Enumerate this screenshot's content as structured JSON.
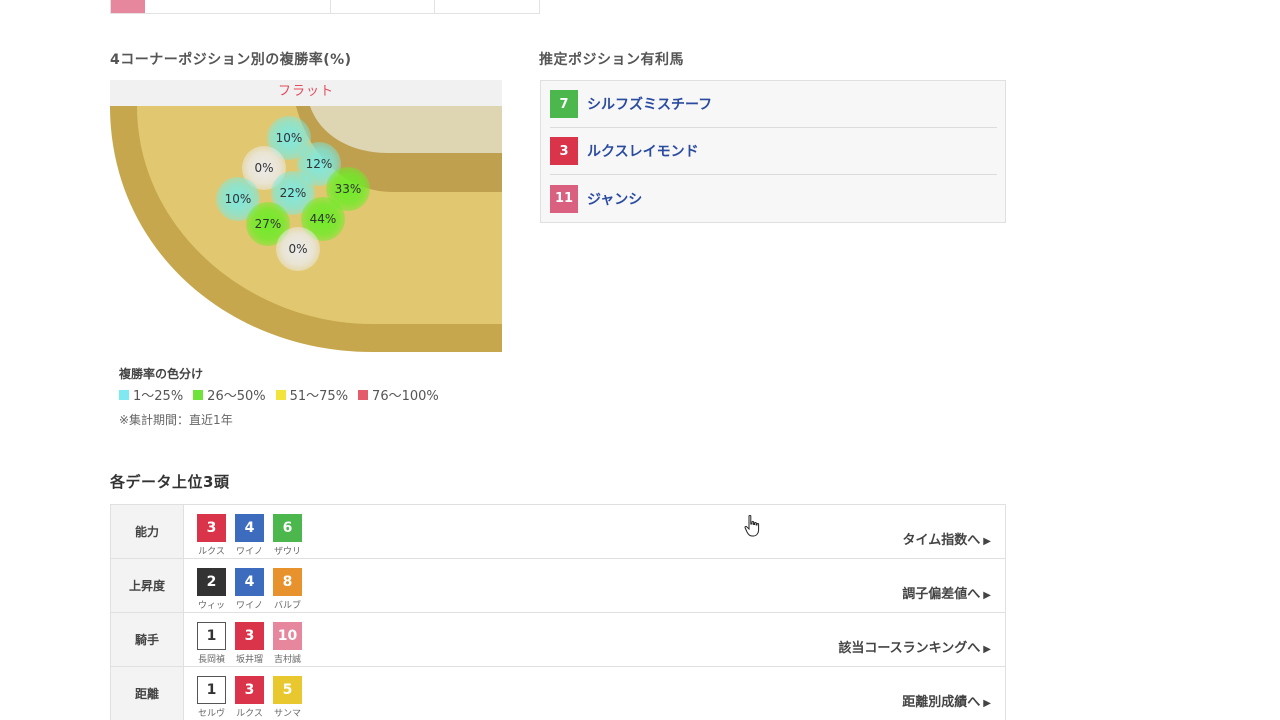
{
  "course_section": {
    "title": "4コーナーポジション別の複勝率(%)",
    "track_condition": "フラット",
    "heat_points": [
      {
        "label": "10%",
        "level": "cyan"
      },
      {
        "label": "12%",
        "level": "cyan"
      },
      {
        "label": "0%",
        "level": "grey"
      },
      {
        "label": "22%",
        "level": "cyan"
      },
      {
        "label": "33%",
        "level": "green"
      },
      {
        "label": "10%",
        "level": "cyan"
      },
      {
        "label": "44%",
        "level": "green"
      },
      {
        "label": "27%",
        "level": "green"
      },
      {
        "label": "0%",
        "level": "grey"
      }
    ],
    "legend_title": "複勝率の色分け",
    "legend": [
      {
        "label": "1〜25%",
        "color": "#7ee9f0"
      },
      {
        "label": "26〜50%",
        "color": "#6fe33a"
      },
      {
        "label": "51〜75%",
        "color": "#f2e43a"
      },
      {
        "label": "76〜100%",
        "color": "#e45c6c"
      }
    ],
    "note": "※集計期間：直近1年"
  },
  "recommend_section": {
    "title": "推定ポジション有利馬",
    "horses": [
      {
        "number": "7",
        "name": "シルフズミスチーフ",
        "color": "#4cb74c"
      },
      {
        "number": "3",
        "name": "ルクスレイモンド",
        "color": "#d9344a"
      },
      {
        "number": "11",
        "name": "ジャンシ",
        "color": "#d9607f"
      }
    ]
  },
  "ranking_section": {
    "title": "各データ上位3頭",
    "rows": [
      {
        "label": "能力",
        "link": "タイム指数へ",
        "horses": [
          {
            "number": "3",
            "short": "ルクス",
            "color": "#d9344a"
          },
          {
            "number": "4",
            "short": "ワイノ",
            "color": "#3d6cbf"
          },
          {
            "number": "6",
            "short": "ザウリ",
            "color": "#4cb74c"
          }
        ]
      },
      {
        "label": "上昇度",
        "link": "調子偏差値へ",
        "horses": [
          {
            "number": "2",
            "short": "ウィッ",
            "color": "#333333"
          },
          {
            "number": "4",
            "short": "ワイノ",
            "color": "#3d6cbf"
          },
          {
            "number": "8",
            "short": "バルブ",
            "color": "#e8922e"
          }
        ]
      },
      {
        "label": "騎手",
        "link": "該当コースランキングへ",
        "horses": [
          {
            "number": "1",
            "short": "長岡禎",
            "color": "#ffffff"
          },
          {
            "number": "3",
            "short": "坂井瑠",
            "color": "#d9344a"
          },
          {
            "number": "10",
            "short": "吉村誠",
            "color": "#e6879e"
          }
        ]
      },
      {
        "label": "距離",
        "link": "距離別成績へ",
        "horses": [
          {
            "number": "1",
            "short": "セルヴ",
            "color": "#ffffff"
          },
          {
            "number": "3",
            "short": "ルクス",
            "color": "#d9344a"
          },
          {
            "number": "5",
            "short": "サンマ",
            "color": "#e8c82e"
          }
        ]
      }
    ]
  }
}
